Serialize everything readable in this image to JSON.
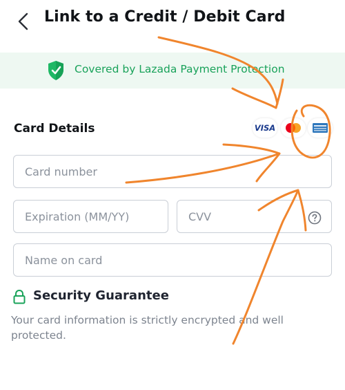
{
  "header": {
    "back_icon": "chevron-left-icon",
    "title": "Link to a Credit / Debit Card"
  },
  "protection_banner": {
    "icon": "shield-check-icon",
    "text": "Covered by Lazada Payment Protection",
    "color": "#19a25a",
    "background": "#eef8f2"
  },
  "card_details": {
    "title": "Card Details",
    "accepted_cards": [
      {
        "name": "visa-logo",
        "label": "VISA"
      },
      {
        "name": "mastercard-logo",
        "label": ""
      },
      {
        "name": "amex-logo",
        "label": ""
      }
    ]
  },
  "form": {
    "card_number": {
      "placeholder": "Card number",
      "value": ""
    },
    "expiration": {
      "placeholder": "Expiration (MM/YY)",
      "value": ""
    },
    "cvv": {
      "placeholder": "CVV",
      "value": "",
      "help_icon": "question-circle-icon"
    },
    "name_on_card": {
      "placeholder": "Name on card",
      "value": ""
    }
  },
  "security": {
    "icon": "lock-icon",
    "title": "Security Guarantee",
    "description": "Your card information is strictly encrypted and well protected."
  },
  "annotation_color": "#f0852d"
}
